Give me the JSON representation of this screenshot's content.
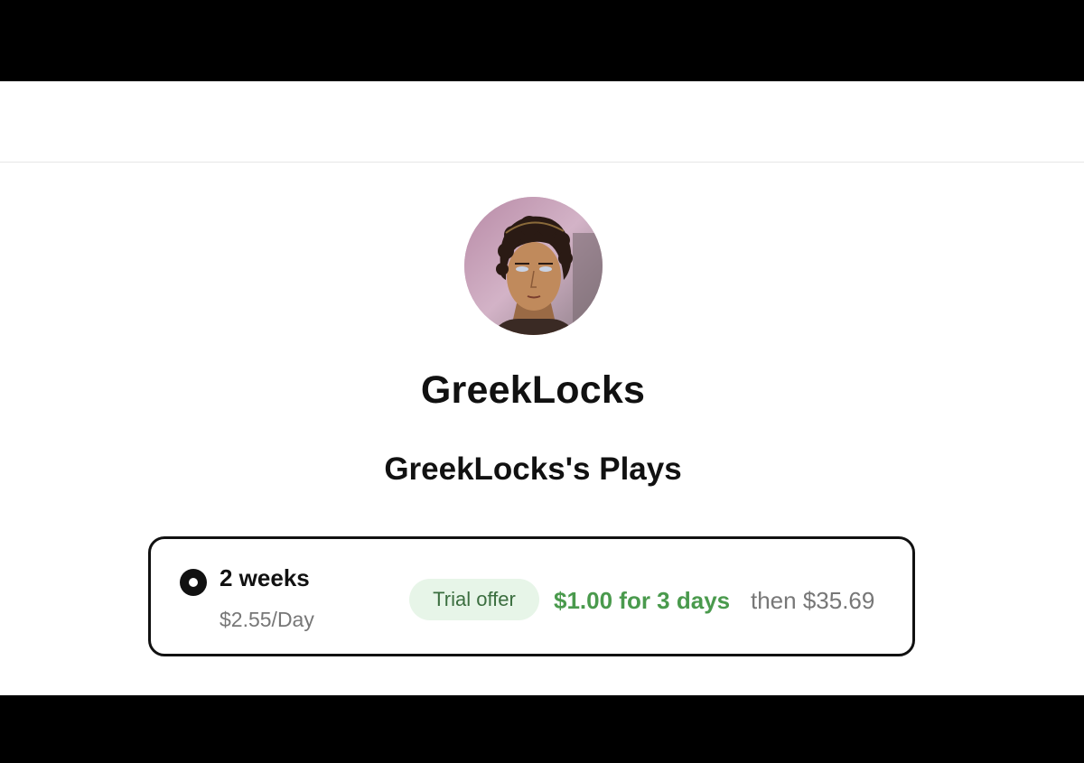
{
  "creator": {
    "name": "GreekLocks",
    "avatar_alt": "avatar"
  },
  "page": {
    "title": "GreekLocks's Plays"
  },
  "plan": {
    "duration": "2 weeks",
    "daily_price": "$2.55/Day",
    "badge": "Trial offer",
    "offer": "$1.00 for 3 days",
    "then": "then $35.69",
    "selected": true
  },
  "colors": {
    "accent_green": "#4a9a4d",
    "badge_bg": "#e7f5e8",
    "text_dark": "#111111",
    "text_muted": "#777777"
  }
}
